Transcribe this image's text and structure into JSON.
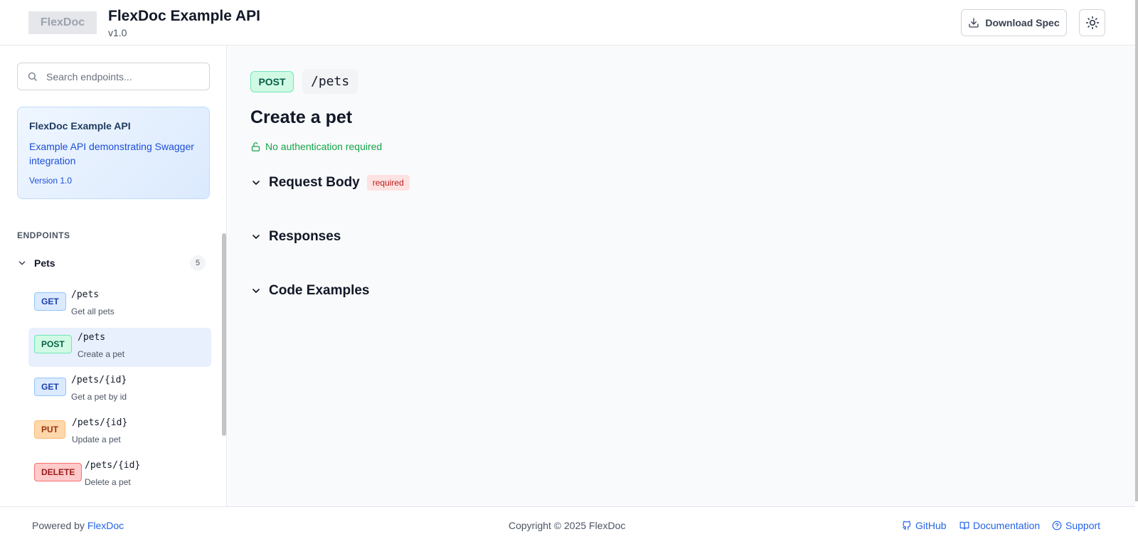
{
  "header": {
    "logo": "FlexDoc",
    "title": "FlexDoc Example API",
    "version": "v1.0",
    "download_label": "Download Spec"
  },
  "sidebar": {
    "search_placeholder": "Search endpoints...",
    "info": {
      "title": "FlexDoc Example API",
      "description": "Example API demonstrating Swagger integration",
      "version": "Version 1.0"
    },
    "endpoints_heading": "ENDPOINTS",
    "group": {
      "label": "Pets",
      "count": "5"
    },
    "endpoints": [
      {
        "method": "GET",
        "path": "/pets",
        "summary": "Get all pets",
        "active": false
      },
      {
        "method": "POST",
        "path": "/pets",
        "summary": "Create a pet",
        "active": true
      },
      {
        "method": "GET",
        "path": "/pets/{id}",
        "summary": "Get a pet by id",
        "active": false
      },
      {
        "method": "PUT",
        "path": "/pets/{id}",
        "summary": "Update a pet",
        "active": false
      },
      {
        "method": "DELETE",
        "path": "/pets/{id}",
        "summary": "Delete a pet",
        "active": false
      }
    ]
  },
  "main": {
    "method": "POST",
    "path": "/pets",
    "title": "Create a pet",
    "auth": "No authentication required",
    "sections": [
      {
        "label": "Request Body",
        "badge": "required"
      },
      {
        "label": "Responses"
      },
      {
        "label": "Code Examples"
      }
    ]
  },
  "footer": {
    "powered_prefix": "Powered by",
    "powered_link": "FlexDoc",
    "copyright": "Copyright © 2025 FlexDoc",
    "links": [
      "GitHub",
      "Documentation",
      "Support"
    ]
  },
  "colors": {
    "get": "#dbeafe",
    "post": "#d1fae5",
    "put": "#fed7aa",
    "delete": "#fecaca",
    "accent": "#2563eb"
  }
}
